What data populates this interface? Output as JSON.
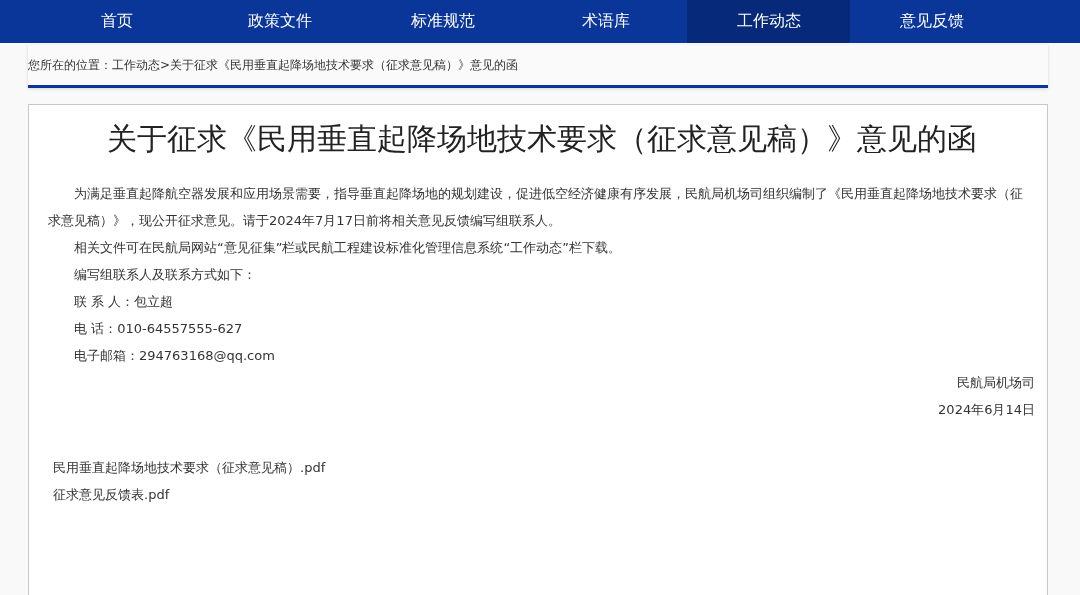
{
  "nav": [
    {
      "label": "首页",
      "selected": false
    },
    {
      "label": "政策文件",
      "selected": false
    },
    {
      "label": "标准规范",
      "selected": false
    },
    {
      "label": "术语库",
      "selected": false
    },
    {
      "label": "工作动态",
      "selected": true
    },
    {
      "label": "意见反馈",
      "selected": false
    }
  ],
  "breadcrumb": {
    "prefix": "您所在的位置：",
    "link": "工作动态",
    "current": ">关于征求《民用垂直起降场地技术要求（征求意见稿）》意见的函"
  },
  "article": {
    "title": "关于征求《民用垂直起降场地技术要求（征求意见稿）》意见的函",
    "paragraphs": [
      "为满足垂直起降航空器发展和应用场景需要，指导垂直起降场地的规划建设，促进低空经济健康有序发展，民航局机场司组织编制了《民用垂直起降场地技术要求（征求意见稿）》，现公开征求意见。请于2024年7月17日前将相关意见反馈编写组联系人。",
      "相关文件可在民航局网站“意见征集”栏或民航工程建设标准化管理信息系统“工作动态”栏下载。",
      "编写组联系人及联系方式如下：",
      "联 系 人：包立超",
      "电 话：010-64557555-627",
      "电子邮箱：294763168@qq.com"
    ],
    "signature": [
      "民航局机场司",
      "2024年6月14日"
    ],
    "attachments": [
      "民用垂直起降场地技术要求（征求意见稿）.pdf",
      "征求意见反馈表.pdf"
    ]
  }
}
